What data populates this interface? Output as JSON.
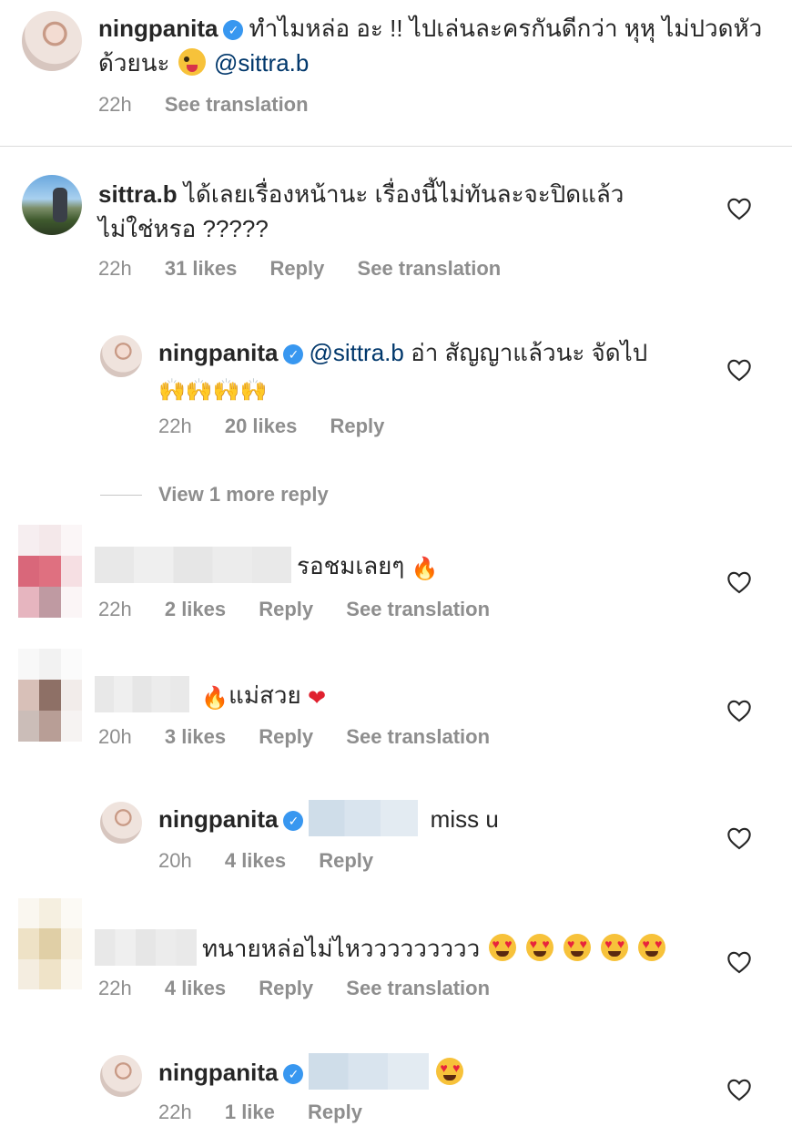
{
  "caption": {
    "username": "ningpanita",
    "text": "ทำไมหล่อ อะ !! ไปเล่นละครกันดีกว่า หุหุ ไม่ปวดหัวด้วยนะ",
    "mention": "@sittra.b",
    "time": "22h",
    "translate": "See translation"
  },
  "comments": [
    {
      "username": "sittra.b",
      "text": "ได้เลยเรื่องหน้านะ เรื่องนี้ไม่ทันละจะปิดแล้ว ไม่ใช่หรอ ?????",
      "time": "22h",
      "likes": "31 likes",
      "reply": "Reply",
      "translate": "See translation"
    },
    {
      "username": "ningpanita",
      "mention": "@sittra.b",
      "text": "อ่า สัญญาแล้วนะ จัดไป",
      "emoji": "🙌🙌🙌🙌",
      "time": "22h",
      "likes": "20 likes",
      "reply": "Reply"
    },
    {
      "text": "รอชมเลยๆ",
      "emoji": "🔥",
      "time": "22h",
      "likes": "2 likes",
      "reply": "Reply",
      "translate": "See translation"
    },
    {
      "text": "แม่สวย",
      "emoji_before": "🔥",
      "emoji_after": "❤",
      "time": "20h",
      "likes": "3 likes",
      "reply": "Reply",
      "translate": "See translation"
    },
    {
      "username": "ningpanita",
      "text": "miss u",
      "time": "20h",
      "likes": "4 likes",
      "reply": "Reply"
    },
    {
      "text": "ทนายหล่อไม่ไหววววววววว",
      "time": "22h",
      "likes": "4 likes",
      "reply": "Reply",
      "translate": "See translation"
    },
    {
      "username": "ningpanita",
      "time": "22h",
      "likes": "1 like",
      "reply": "Reply"
    }
  ],
  "view_more": "View 1 more reply",
  "icons": {
    "verified": "verified-badge-icon",
    "like": "heart-outline-icon"
  },
  "colors": {
    "verified": "#3897f0",
    "mention": "#00376b",
    "meta": "#8e8e8e",
    "text": "#262626"
  }
}
